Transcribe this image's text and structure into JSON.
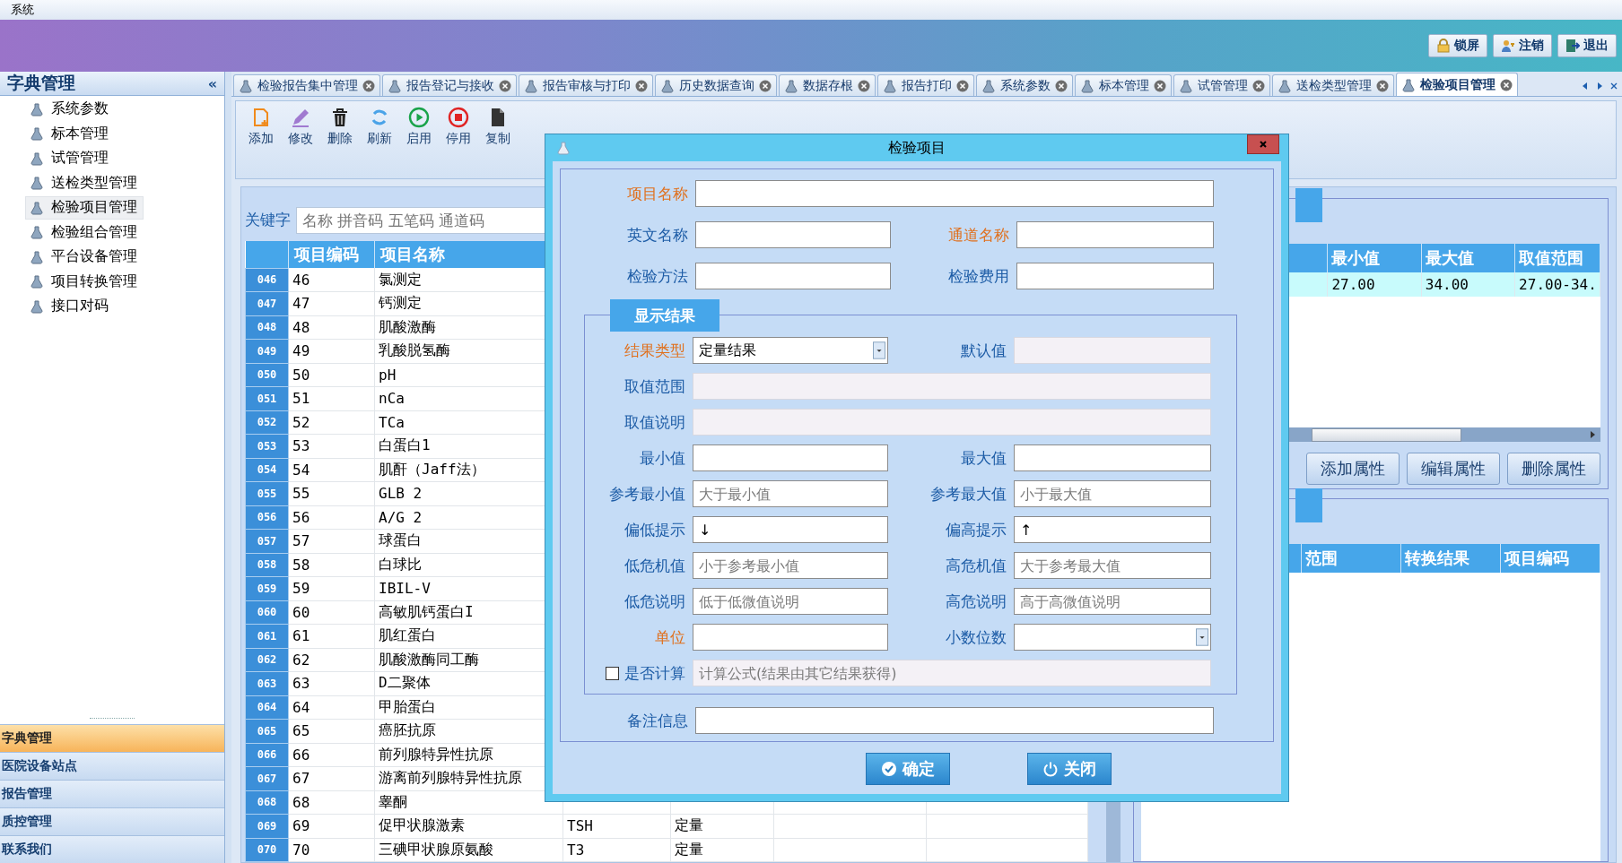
{
  "menu_bar": {
    "items": [
      "系统"
    ]
  },
  "header": {
    "buttons": [
      {
        "label": "锁屏"
      },
      {
        "label": "注销"
      },
      {
        "label": "退出"
      }
    ]
  },
  "sidebar": {
    "title": "字典管理",
    "collapse": "«",
    "items": [
      {
        "label": "系统参数",
        "selected": false
      },
      {
        "label": "标本管理",
        "selected": false
      },
      {
        "label": "试管管理",
        "selected": false
      },
      {
        "label": "送检类型管理",
        "selected": false
      },
      {
        "label": "检验项目管理",
        "selected": true
      },
      {
        "label": "检验组合管理",
        "selected": false
      },
      {
        "label": "平台设备管理",
        "selected": false
      },
      {
        "label": "项目转换管理",
        "selected": false
      },
      {
        "label": "接口对码",
        "selected": false
      }
    ],
    "sections": [
      {
        "label": "字典管理",
        "selected": true
      },
      {
        "label": "医院设备站点",
        "selected": false
      },
      {
        "label": "报告管理",
        "selected": false
      },
      {
        "label": "质控管理",
        "selected": false
      },
      {
        "label": "联系我们",
        "selected": false
      }
    ]
  },
  "tabs": [
    {
      "label": "检验报告集中管理",
      "selected": false
    },
    {
      "label": "报告登记与接收",
      "selected": false
    },
    {
      "label": "报告审核与打印",
      "selected": false
    },
    {
      "label": "历史数据查询",
      "selected": false
    },
    {
      "label": "数据存根",
      "selected": false
    },
    {
      "label": "报告打印",
      "selected": false
    },
    {
      "label": "系统参数",
      "selected": false
    },
    {
      "label": "标本管理",
      "selected": false
    },
    {
      "label": "试管管理",
      "selected": false
    },
    {
      "label": "送检类型管理",
      "selected": false
    },
    {
      "label": "检验项目管理",
      "selected": true
    }
  ],
  "toolbar": [
    {
      "label": "添加"
    },
    {
      "label": "修改"
    },
    {
      "label": "删除"
    },
    {
      "label": "刷新"
    },
    {
      "label": "启用"
    },
    {
      "label": "停用"
    },
    {
      "label": "复制"
    }
  ],
  "search": {
    "label": "关键字",
    "placeholder": "名称 拼音码 五笔码 通道码"
  },
  "table": {
    "columns": [
      "项目编码",
      "项目名称"
    ],
    "rows": [
      {
        "index": "046",
        "code": "46",
        "name": "氯测定"
      },
      {
        "index": "047",
        "code": "47",
        "name": "钙测定"
      },
      {
        "index": "048",
        "code": "48",
        "name": "肌酸激酶"
      },
      {
        "index": "049",
        "code": "49",
        "name": "乳酸脱氢酶"
      },
      {
        "index": "050",
        "code": "50",
        "name": "pH"
      },
      {
        "index": "051",
        "code": "51",
        "name": "nCa"
      },
      {
        "index": "052",
        "code": "52",
        "name": "TCa"
      },
      {
        "index": "053",
        "code": "53",
        "name": "白蛋白1"
      },
      {
        "index": "054",
        "code": "54",
        "name": "肌酐（Jaff法）"
      },
      {
        "index": "055",
        "code": "55",
        "name": "GLB 2"
      },
      {
        "index": "056",
        "code": "56",
        "name": "A/G 2"
      },
      {
        "index": "057",
        "code": "57",
        "name": "球蛋白"
      },
      {
        "index": "058",
        "code": "58",
        "name": "白球比"
      },
      {
        "index": "059",
        "code": "59",
        "name": "IBIL-V"
      },
      {
        "index": "060",
        "code": "60",
        "name": "高敏肌钙蛋白I"
      },
      {
        "index": "061",
        "code": "61",
        "name": "肌红蛋白"
      },
      {
        "index": "062",
        "code": "62",
        "name": "肌酸激酶同工酶"
      },
      {
        "index": "063",
        "code": "63",
        "name": "D二聚体"
      },
      {
        "index": "064",
        "code": "64",
        "name": "甲胎蛋白"
      },
      {
        "index": "065",
        "code": "65",
        "name": "癌胚抗原"
      },
      {
        "index": "066",
        "code": "66",
        "name": "前列腺特异性抗原"
      },
      {
        "index": "067",
        "code": "67",
        "name": "游离前列腺特异性抗原"
      },
      {
        "index": "068",
        "code": "68",
        "name": "睾酮"
      },
      {
        "index": "069",
        "code": "69",
        "name": "促甲状腺激素",
        "column_3": "TSH",
        "column_4": "定量"
      },
      {
        "index": "070",
        "code": "70",
        "name": "三碘甲状腺原氨酸",
        "column_3": "T3",
        "column_4": "定量"
      }
    ]
  },
  "properties": {
    "columns": [
      "最小值",
      "最大值",
      "取值范围"
    ],
    "rows": [
      [
        "27.00",
        "34.00",
        "27.00-34."
      ]
    ],
    "buttons": [
      "添加属性",
      "编辑属性",
      "删除属性"
    ]
  },
  "conversions": {
    "columns": [
      "范围",
      "转换结果",
      "项目编码"
    ]
  },
  "dialog": {
    "title": "检验项目",
    "rows": [
      [
        {
          "label": "项目名称",
          "required": true,
          "kind": "text"
        }
      ],
      [
        {
          "label": "英文名称",
          "required": false,
          "kind": "text"
        },
        {
          "label": "通道名称",
          "required": true,
          "kind": "text"
        }
      ],
      [
        {
          "label": "检验方法",
          "required": false,
          "kind": "text"
        },
        {
          "label": "检验费用",
          "required": false,
          "kind": "text"
        }
      ]
    ],
    "group": {
      "title": "显示结果",
      "rows": [
        [
          {
            "label": "结果类型",
            "required": true,
            "kind": "combo",
            "value": "定量结果"
          },
          {
            "label": "默认值",
            "required": false,
            "kind": "disabled"
          }
        ],
        [
          {
            "label": "取值范围",
            "required": false,
            "kind": "disabled"
          }
        ],
        [
          {
            "label": "取值说明",
            "required": false,
            "kind": "disabled"
          }
        ],
        [
          {
            "label": "最小值",
            "required": false,
            "kind": "text"
          },
          {
            "label": "最大值",
            "required": false,
            "kind": "text"
          }
        ],
        [
          {
            "label": "参考最小值",
            "required": false,
            "kind": "text",
            "placeholder": "大于最小值"
          },
          {
            "label": "参考最大值",
            "required": false,
            "kind": "text",
            "placeholder": "小于最大值"
          }
        ],
        [
          {
            "label": "偏低提示",
            "required": false,
            "kind": "text",
            "value": "↓"
          },
          {
            "label": "偏高提示",
            "required": false,
            "kind": "text",
            "value": "↑"
          }
        ],
        [
          {
            "label": "低危机值",
            "required": false,
            "kind": "text",
            "placeholder": "小于参考最小值"
          },
          {
            "label": "高危机值",
            "required": false,
            "kind": "text",
            "placeholder": "大于参考最大值"
          }
        ],
        [
          {
            "label": "低危说明",
            "required": false,
            "kind": "text",
            "placeholder": "低于低微值说明"
          },
          {
            "label": "高危说明",
            "required": false,
            "kind": "text",
            "placeholder": "高于高微值说明"
          }
        ],
        [
          {
            "label": "单位",
            "required": true,
            "kind": "text"
          },
          {
            "label": "小数位数",
            "required": false,
            "kind": "combo"
          }
        ]
      ],
      "calc": {
        "label": "是否计算",
        "checked": false,
        "placeholder": "计算公式(结果由其它结果获得)"
      }
    },
    "remark": {
      "label": "备注信息",
      "required": false,
      "kind": "text"
    },
    "buttons": [
      {
        "label": "确定"
      },
      {
        "label": "关闭"
      }
    ]
  }
}
